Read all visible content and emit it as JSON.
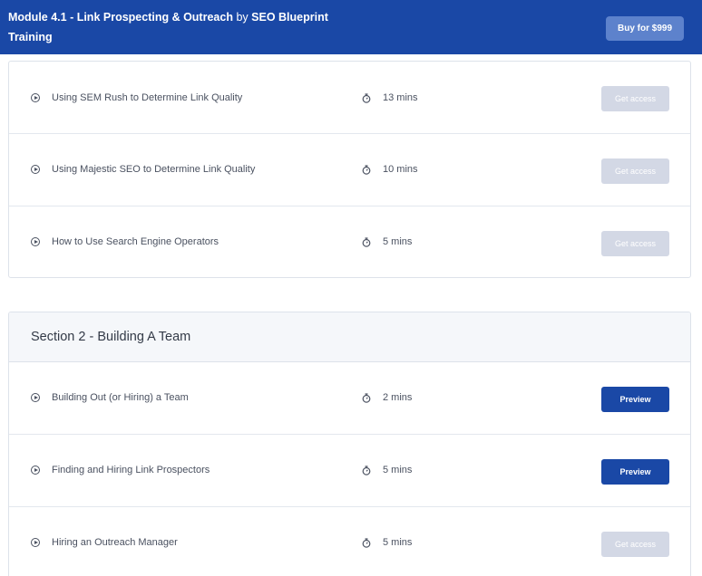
{
  "header": {
    "module_title": "Module 4.1 - Link Prospecting & Outreach",
    "by_text": "by",
    "author": "SEO Blueprint",
    "author_cont": "Training",
    "buy_label": "Buy for $999"
  },
  "sections": [
    {
      "title": "",
      "lessons": [
        {
          "title": "Using SEM Rush to Determine Link Quality",
          "duration": "13 mins",
          "action": "Get access",
          "type": "locked"
        },
        {
          "title": "Using Majestic SEO to Determine Link Quality",
          "duration": "10 mins",
          "action": "Get access",
          "type": "locked"
        },
        {
          "title": "How to Use Search Engine Operators",
          "duration": "5 mins",
          "action": "Get access",
          "type": "locked"
        }
      ]
    },
    {
      "title": "Section 2 - Building A Team",
      "lessons": [
        {
          "title": "Building Out (or Hiring) a Team",
          "duration": "2 mins",
          "action": "Preview",
          "type": "preview"
        },
        {
          "title": "Finding and Hiring Link Prospectors",
          "duration": "5 mins",
          "action": "Preview",
          "type": "preview"
        },
        {
          "title": "Hiring an Outreach Manager",
          "duration": "5 mins",
          "action": "Get access",
          "type": "locked"
        }
      ]
    }
  ],
  "icons": {
    "lesson": "play-circle-icon",
    "duration": "stopwatch-icon"
  },
  "colors": {
    "brand": "#1a48a6",
    "buy_button": "#5d82cc",
    "locked_button": "#d3d8e5"
  }
}
